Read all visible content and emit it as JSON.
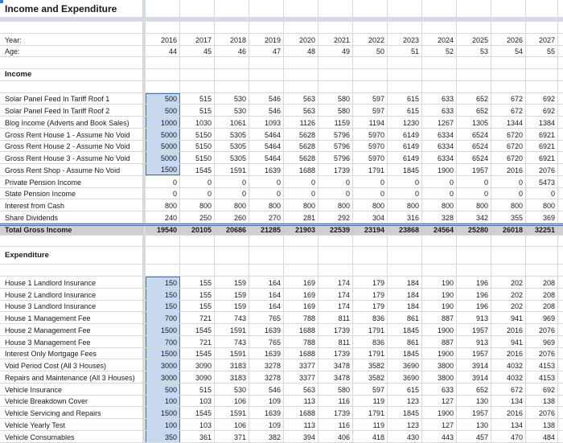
{
  "sheet": {
    "title": "Income and Expenditure",
    "year_label": "Year:",
    "age_label": "Age:",
    "years": [
      "2016",
      "2017",
      "2018",
      "2019",
      "2020",
      "2021",
      "2022",
      "2023",
      "2024",
      "2025",
      "2026",
      "2027"
    ],
    "ages": [
      "44",
      "45",
      "46",
      "47",
      "48",
      "49",
      "50",
      "51",
      "52",
      "53",
      "54",
      "55"
    ],
    "income": {
      "heading": "Income",
      "rows": [
        {
          "label": "Solar Panel Feed In Tariff Roof 1",
          "values": [
            "500",
            "515",
            "530",
            "546",
            "563",
            "580",
            "597",
            "615",
            "633",
            "652",
            "672",
            "692"
          ]
        },
        {
          "label": "Solar Panel Feed In Tariff Roof 2",
          "values": [
            "500",
            "515",
            "530",
            "546",
            "563",
            "580",
            "597",
            "615",
            "633",
            "652",
            "672",
            "692"
          ]
        },
        {
          "label": "Blog Income (Adverts and Book Sales)",
          "values": [
            "1000",
            "1030",
            "1061",
            "1093",
            "1126",
            "1159",
            "1194",
            "1230",
            "1267",
            "1305",
            "1344",
            "1384"
          ]
        },
        {
          "label": "Gross Rent House 1 - Assume No Void",
          "values": [
            "5000",
            "5150",
            "5305",
            "5464",
            "5628",
            "5796",
            "5970",
            "6149",
            "6334",
            "6524",
            "6720",
            "6921"
          ]
        },
        {
          "label": "Gross Rent House 2 - Assume No Void",
          "values": [
            "5000",
            "5150",
            "5305",
            "5464",
            "5628",
            "5796",
            "5970",
            "6149",
            "6334",
            "6524",
            "6720",
            "6921"
          ]
        },
        {
          "label": "Gross Rent House 3 - Assume No Void",
          "values": [
            "5000",
            "5150",
            "5305",
            "5464",
            "5628",
            "5796",
            "5970",
            "6149",
            "6334",
            "6524",
            "6720",
            "6921"
          ]
        },
        {
          "label": "Gross Rent Shop - Assume No Void",
          "values": [
            "1500",
            "1545",
            "1591",
            "1639",
            "1688",
            "1739",
            "1791",
            "1845",
            "1900",
            "1957",
            "2016",
            "2076"
          ]
        },
        {
          "label": "Private Pension Income",
          "values": [
            "0",
            "0",
            "0",
            "0",
            "0",
            "0",
            "0",
            "0",
            "0",
            "0",
            "0",
            "5473"
          ]
        },
        {
          "label": "State Pension Income",
          "values": [
            "0",
            "0",
            "0",
            "0",
            "0",
            "0",
            "0",
            "0",
            "0",
            "0",
            "0",
            "0"
          ]
        },
        {
          "label": "Interest from Cash",
          "values": [
            "800",
            "800",
            "800",
            "800",
            "800",
            "800",
            "800",
            "800",
            "800",
            "800",
            "800",
            "800"
          ]
        },
        {
          "label": "Share Dividends",
          "values": [
            "240",
            "250",
            "260",
            "270",
            "281",
            "292",
            "304",
            "316",
            "328",
            "342",
            "355",
            "369"
          ]
        }
      ],
      "input_rows": 7,
      "total": {
        "label": "Total Gross Income",
        "values": [
          "19540",
          "20105",
          "20686",
          "21285",
          "21903",
          "22539",
          "23194",
          "23868",
          "24564",
          "25280",
          "26018",
          "32251"
        ]
      }
    },
    "expenditure": {
      "heading": "Expenditure",
      "rows": [
        {
          "label": "House 1 Landlord Insurance",
          "values": [
            "150",
            "155",
            "159",
            "164",
            "169",
            "174",
            "179",
            "184",
            "190",
            "196",
            "202",
            "208"
          ]
        },
        {
          "label": "House 2 Landlord Insurance",
          "values": [
            "150",
            "155",
            "159",
            "164",
            "169",
            "174",
            "179",
            "184",
            "190",
            "196",
            "202",
            "208"
          ]
        },
        {
          "label": "House 3 Landlord Insurance",
          "values": [
            "150",
            "155",
            "159",
            "164",
            "169",
            "174",
            "179",
            "184",
            "190",
            "196",
            "202",
            "208"
          ]
        },
        {
          "label": "House 1 Management Fee",
          "values": [
            "700",
            "721",
            "743",
            "765",
            "788",
            "811",
            "836",
            "861",
            "887",
            "913",
            "941",
            "969"
          ]
        },
        {
          "label": "House 2 Management Fee",
          "values": [
            "1500",
            "1545",
            "1591",
            "1639",
            "1688",
            "1739",
            "1791",
            "1845",
            "1900",
            "1957",
            "2016",
            "2076"
          ]
        },
        {
          "label": "House 3 Management Fee",
          "values": [
            "700",
            "721",
            "743",
            "765",
            "788",
            "811",
            "836",
            "861",
            "887",
            "913",
            "941",
            "969"
          ]
        },
        {
          "label": "Interest Only Mortgage Fees",
          "values": [
            "1500",
            "1545",
            "1591",
            "1639",
            "1688",
            "1739",
            "1791",
            "1845",
            "1900",
            "1957",
            "2016",
            "2076"
          ]
        },
        {
          "label": "Void Period Cost (All 3 Houses)",
          "values": [
            "3000",
            "3090",
            "3183",
            "3278",
            "3377",
            "3478",
            "3582",
            "3690",
            "3800",
            "3914",
            "4032",
            "4153"
          ]
        },
        {
          "label": "Repairs and Maintenance (All 3 Houses)",
          "values": [
            "3000",
            "3090",
            "3183",
            "3278",
            "3377",
            "3478",
            "3582",
            "3690",
            "3800",
            "3914",
            "4032",
            "4153"
          ]
        },
        {
          "label": "Vehicle Insurance",
          "values": [
            "500",
            "515",
            "530",
            "546",
            "563",
            "580",
            "597",
            "615",
            "633",
            "652",
            "672",
            "692"
          ]
        },
        {
          "label": "Vehicle Breakdown Cover",
          "values": [
            "100",
            "103",
            "106",
            "109",
            "113",
            "116",
            "119",
            "123",
            "127",
            "130",
            "134",
            "138"
          ]
        },
        {
          "label": "Vehicle Servicing and Repairs",
          "values": [
            "1500",
            "1545",
            "1591",
            "1639",
            "1688",
            "1739",
            "1791",
            "1845",
            "1900",
            "1957",
            "2016",
            "2076"
          ]
        },
        {
          "label": "Vehicle Yearly Test",
          "values": [
            "100",
            "103",
            "106",
            "109",
            "113",
            "116",
            "119",
            "123",
            "127",
            "130",
            "134",
            "138"
          ]
        },
        {
          "label": "Vehicle Consumables",
          "values": [
            "350",
            "361",
            "371",
            "382",
            "394",
            "406",
            "418",
            "430",
            "443",
            "457",
            "470",
            "484"
          ]
        }
      ]
    }
  }
}
